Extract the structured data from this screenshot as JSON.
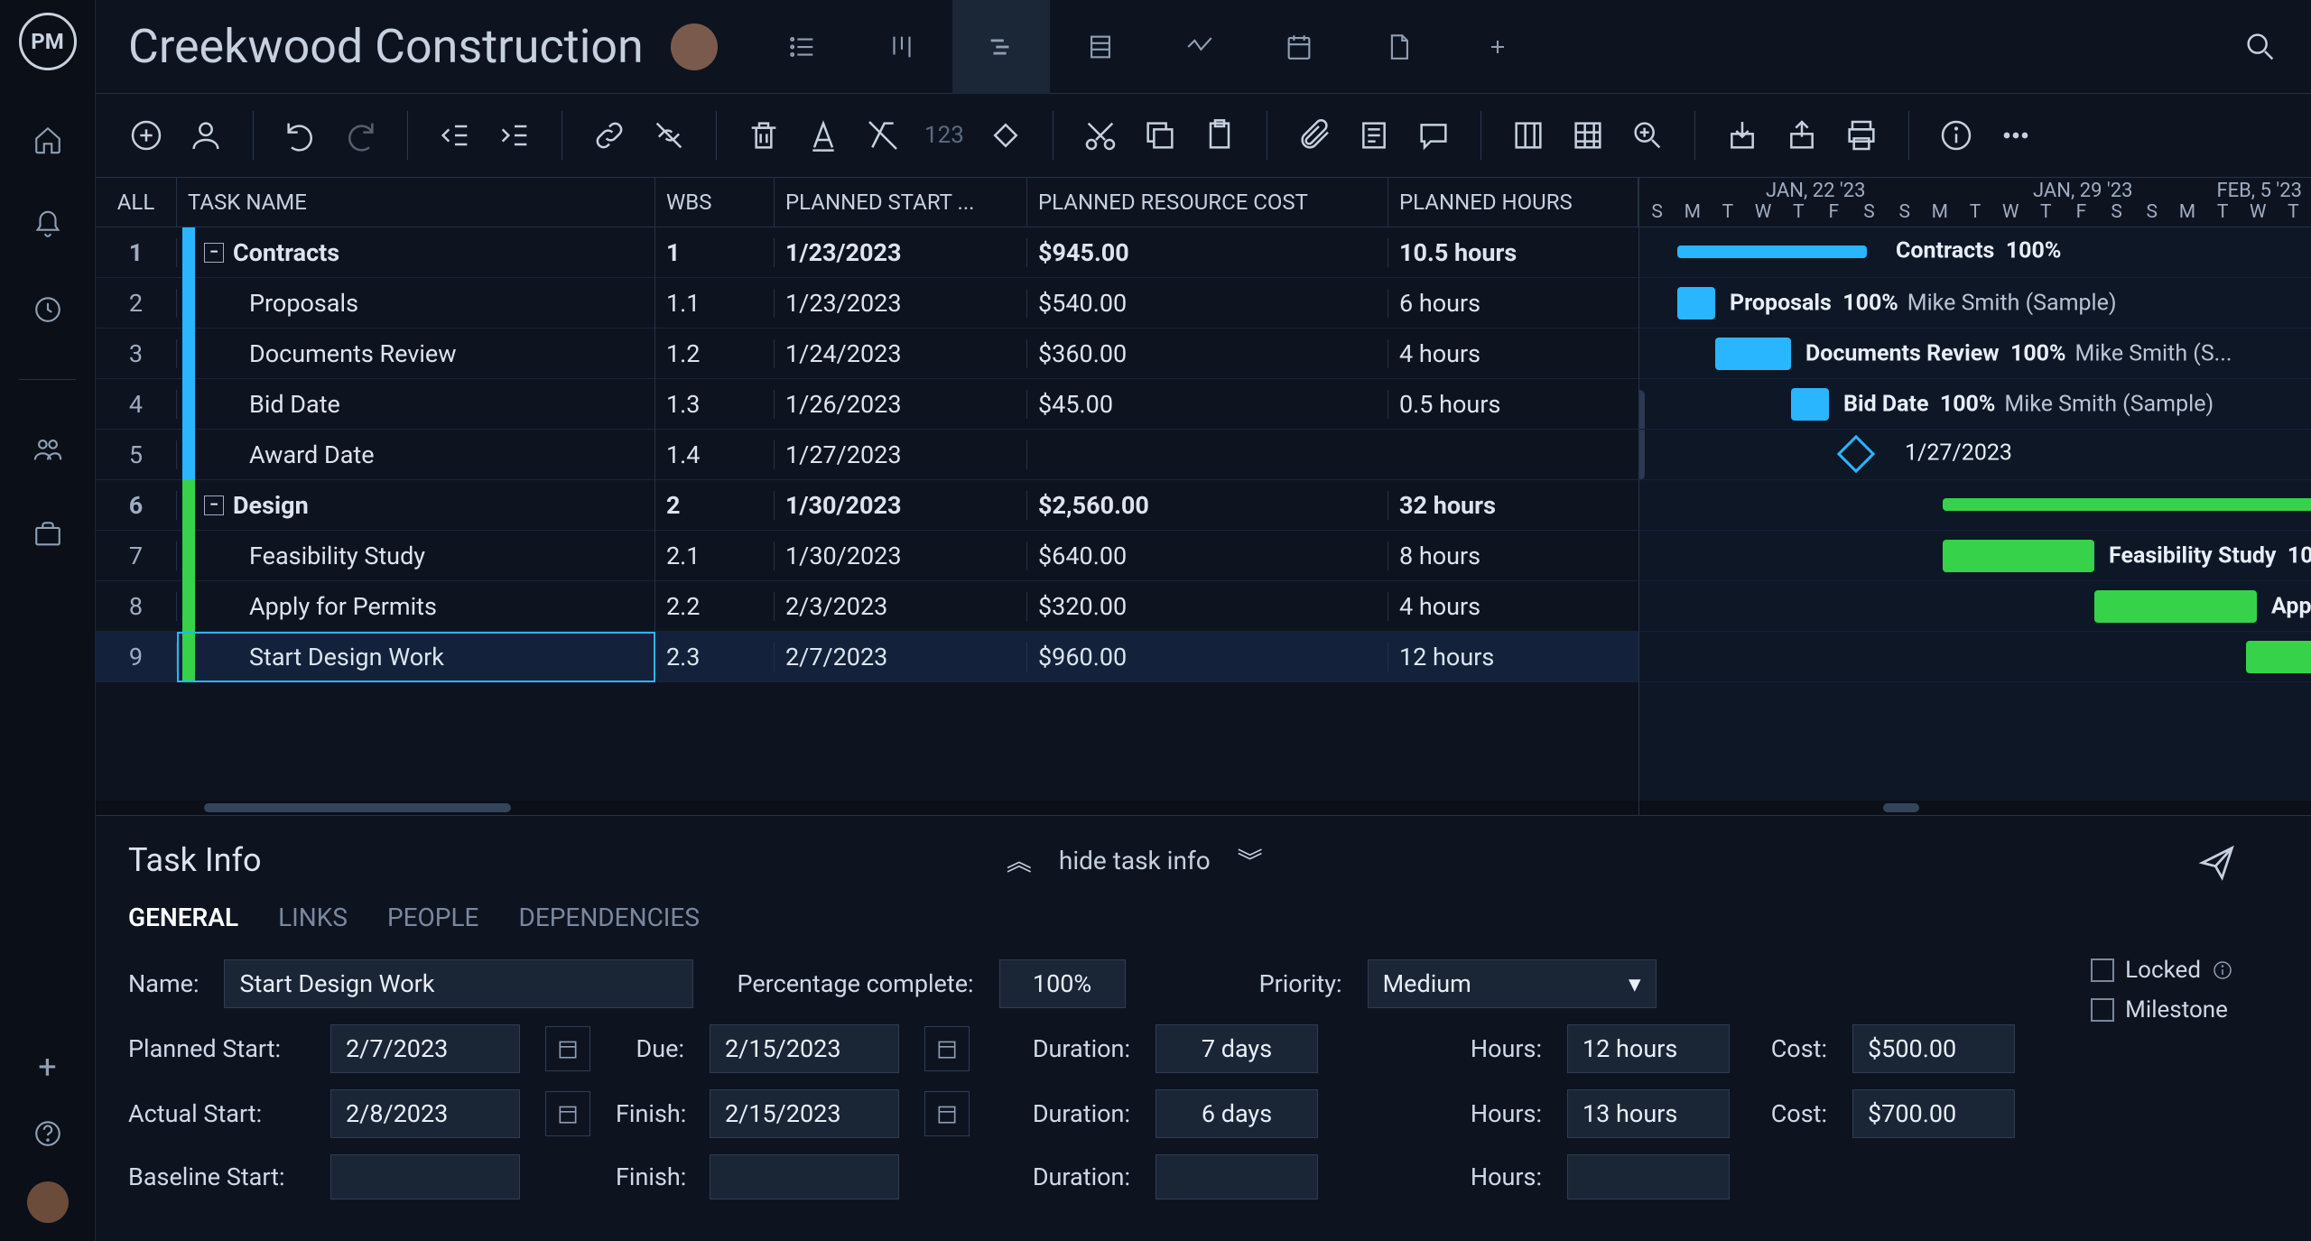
{
  "project": {
    "title": "Creekwood Construction"
  },
  "table": {
    "headers": {
      "all": "ALL",
      "name": "TASK NAME",
      "wbs": "WBS",
      "start": "PLANNED START ...",
      "cost": "PLANNED RESOURCE COST",
      "hours": "PLANNED HOURS"
    },
    "rows": [
      {
        "num": "1",
        "group": true,
        "color": "#2ab6ff",
        "name": "Contracts",
        "wbs": "1",
        "start": "1/23/2023",
        "cost": "$945.00",
        "hours": "10.5 hours"
      },
      {
        "num": "2",
        "group": false,
        "color": "#2ab6ff",
        "name": "Proposals",
        "wbs": "1.1",
        "start": "1/23/2023",
        "cost": "$540.00",
        "hours": "6 hours"
      },
      {
        "num": "3",
        "group": false,
        "color": "#2ab6ff",
        "name": "Documents Review",
        "wbs": "1.2",
        "start": "1/24/2023",
        "cost": "$360.00",
        "hours": "4 hours"
      },
      {
        "num": "4",
        "group": false,
        "color": "#2ab6ff",
        "name": "Bid Date",
        "wbs": "1.3",
        "start": "1/26/2023",
        "cost": "$45.00",
        "hours": "0.5 hours"
      },
      {
        "num": "5",
        "group": false,
        "color": "#2ab6ff",
        "name": "Award Date",
        "wbs": "1.4",
        "start": "1/27/2023",
        "cost": "",
        "hours": ""
      },
      {
        "num": "6",
        "group": true,
        "color": "#35d24a",
        "name": "Design",
        "wbs": "2",
        "start": "1/30/2023",
        "cost": "$2,560.00",
        "hours": "32 hours"
      },
      {
        "num": "7",
        "group": false,
        "color": "#35d24a",
        "name": "Feasibility Study",
        "wbs": "2.1",
        "start": "1/30/2023",
        "cost": "$640.00",
        "hours": "8 hours"
      },
      {
        "num": "8",
        "group": false,
        "color": "#35d24a",
        "name": "Apply for Permits",
        "wbs": "2.2",
        "start": "2/3/2023",
        "cost": "$320.00",
        "hours": "4 hours"
      },
      {
        "num": "9",
        "group": false,
        "selected": true,
        "color": "#35d24a",
        "name": "Start Design Work",
        "wbs": "2.3",
        "start": "2/7/2023",
        "cost": "$960.00",
        "hours": "12 hours"
      }
    ]
  },
  "timeline": {
    "weeks": [
      "JAN, 22 '23",
      "JAN, 29 '23",
      "FEB, 5 '23"
    ],
    "days": [
      "S",
      "M",
      "T",
      "W",
      "T",
      "F",
      "S",
      "S",
      "M",
      "T",
      "W",
      "T",
      "F",
      "S",
      "S",
      "M",
      "T",
      "W",
      "T"
    ],
    "bars": [
      {
        "label": "Contracts",
        "pct": "100%",
        "assignee": ""
      },
      {
        "label": "Proposals",
        "pct": "100%",
        "assignee": "Mike Smith (Sample)"
      },
      {
        "label": "Documents Review",
        "pct": "100%",
        "assignee": "Mike Smith (S..."
      },
      {
        "label": "Bid Date",
        "pct": "100%",
        "assignee": "Mike Smith (Sample)"
      },
      {
        "label": "1/27/2023",
        "pct": "",
        "assignee": ""
      },
      {
        "label": "",
        "pct": "",
        "assignee": ""
      },
      {
        "label": "Feasibility Study",
        "pct": "10",
        "assignee": ""
      },
      {
        "label": "Apply f",
        "pct": "",
        "assignee": ""
      }
    ]
  },
  "taskInfo": {
    "title": "Task Info",
    "hideLabel": "hide task info",
    "tabs": [
      "GENERAL",
      "LINKS",
      "PEOPLE",
      "DEPENDENCIES"
    ],
    "labels": {
      "name": "Name:",
      "pct": "Percentage complete:",
      "priority": "Priority:",
      "locked": "Locked",
      "milestone": "Milestone",
      "plannedStart": "Planned Start:",
      "due": "Due:",
      "duration": "Duration:",
      "hours": "Hours:",
      "cost": "Cost:",
      "actualStart": "Actual Start:",
      "finish": "Finish:",
      "baselineStart": "Baseline Start:"
    },
    "values": {
      "name": "Start Design Work",
      "pct": "100%",
      "priority": "Medium",
      "plannedStart": "2/7/2023",
      "due": "2/15/2023",
      "plannedDuration": "7 days",
      "plannedHours": "12 hours",
      "plannedCost": "$500.00",
      "actualStart": "2/8/2023",
      "actualFinish": "2/15/2023",
      "actualDuration": "6 days",
      "actualHours": "13 hours",
      "actualCost": "$700.00",
      "baselineStart": "",
      "baselineFinish": "",
      "baselineDuration": "",
      "baselineHours": ""
    }
  },
  "toolbar": {
    "numPlaceholder": "123"
  }
}
